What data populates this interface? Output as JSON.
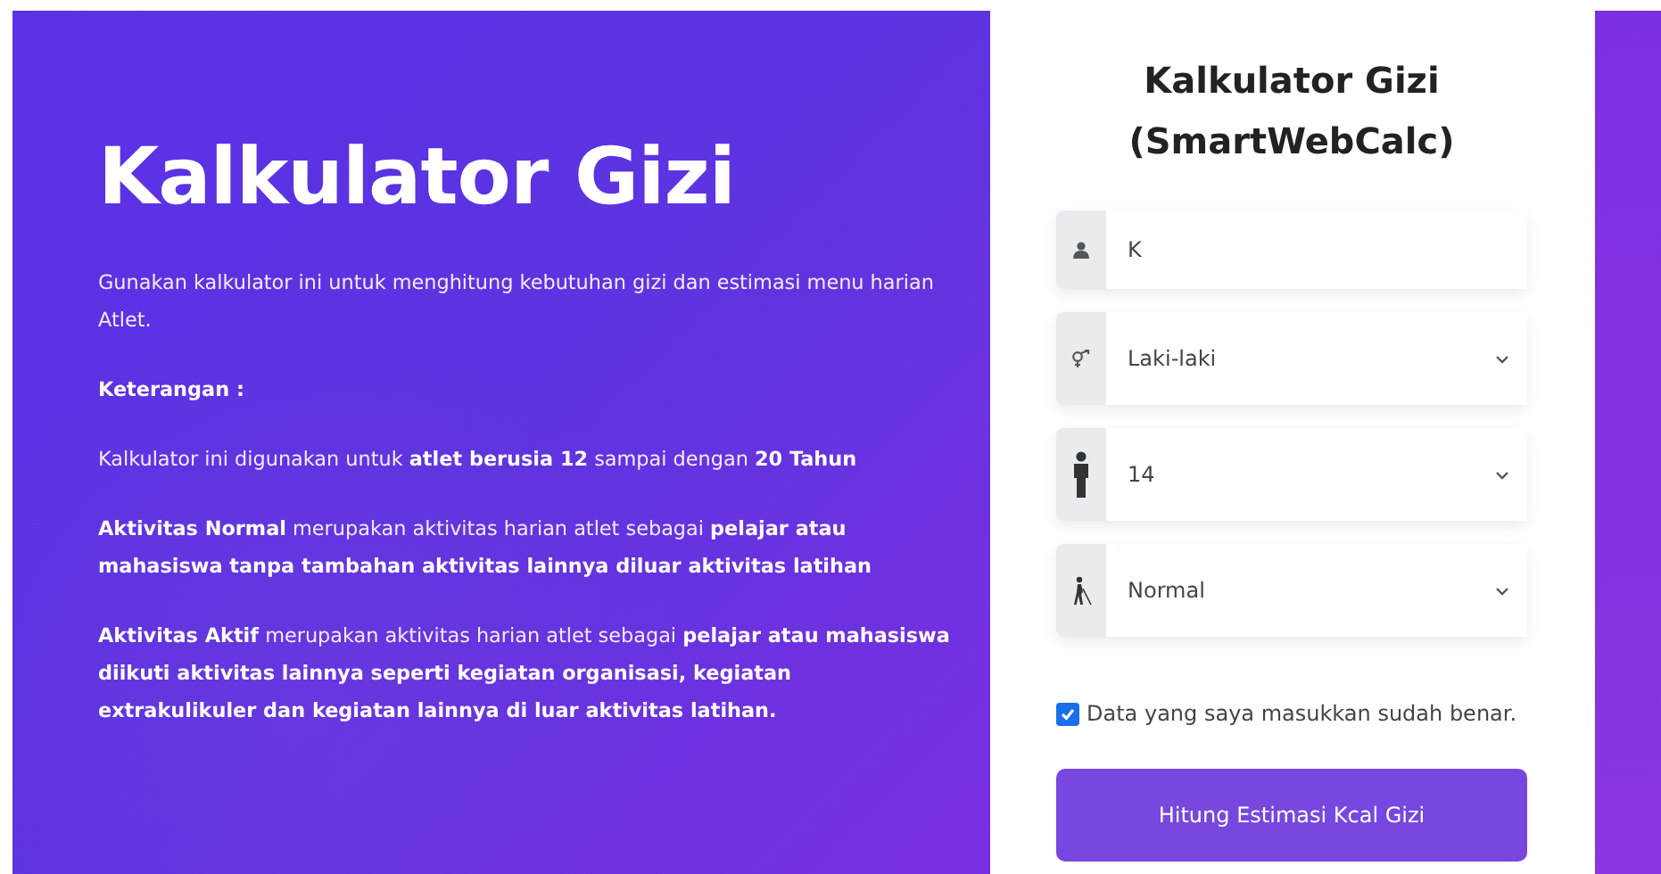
{
  "hero": {
    "title": "Kalkulator Gizi",
    "intro": "Gunakan kalkulator ini untuk menghitung kebutuhan gizi dan estimasi menu harian Atlet.",
    "notes_heading": "Keterangan :",
    "notes": [
      "Kalkulator ini digunakan untuk **atlet berusia 12** sampai dengan **20 Tahun**",
      "**Aktivitas Normal** merupakan aktivitas harian atlet sebagai **pelajar atau mahasiswa tanpa tambahan aktivitas lainnya diluar aktivitas latihan**",
      "**Aktivitas Aktif** merupakan aktivitas harian atlet sebagai **pelajar atau mahasiswa diikuti aktivitas lainnya seperti kegiatan organisasi, kegiatan extrakulikuler dan kegiatan lainnya di luar aktivitas latihan.**"
    ]
  },
  "form": {
    "title_lines": [
      "Kalkulator Gizi",
      "(SmartWebCalc)"
    ],
    "fields": [
      {
        "kind": "input",
        "value": "K"
      },
      {
        "kind": "select",
        "value": "Laki-laki"
      },
      {
        "kind": "select",
        "value": "14"
      },
      {
        "kind": "select",
        "value": "Normal"
      }
    ],
    "confirm": {
      "label": "Data yang saya masukkan sudah benar.",
      "checked": true
    },
    "submit": "Hitung Estimasi Kcal Gizi"
  }
}
